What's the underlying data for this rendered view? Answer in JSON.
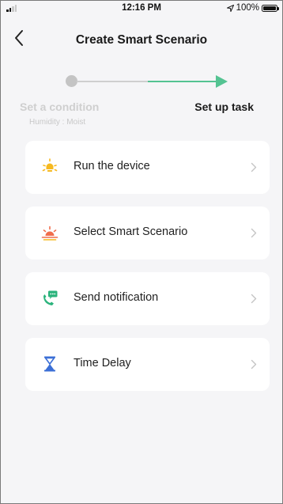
{
  "status_bar": {
    "time": "12:16 PM",
    "battery": "100%",
    "signal_icon": "signal-bars-icon",
    "location_icon": "location-arrow-icon",
    "battery_icon": "battery-icon"
  },
  "header": {
    "title": "Create Smart Scenario",
    "back_icon": "chevron-left-icon"
  },
  "stepper": {
    "step1_label": "Set a condition",
    "step1_subtitle": "Humidity : Moist",
    "step2_label": "Set up task",
    "active_color": "#54c392",
    "inactive_color": "#c4c4c4"
  },
  "tasks": [
    {
      "label": "Run the device",
      "icon": "lightbulb-icon"
    },
    {
      "label": "Select Smart Scenario",
      "icon": "sunrise-icon"
    },
    {
      "label": "Send notification",
      "icon": "phone-message-icon"
    },
    {
      "label": "Time Delay",
      "icon": "hourglass-icon"
    }
  ]
}
